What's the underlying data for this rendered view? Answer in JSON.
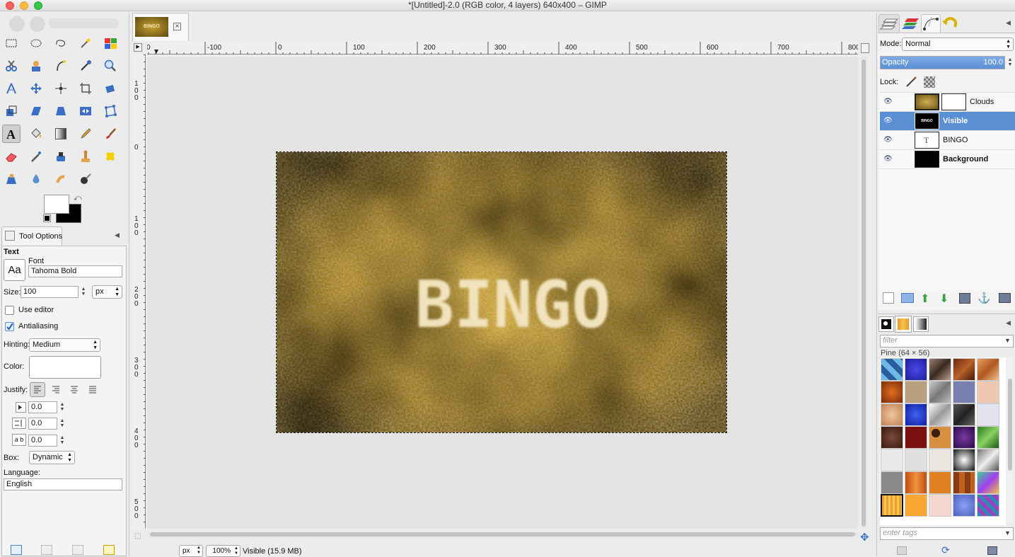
{
  "window": {
    "title": "*[Untitled]-2.0 (RGB color, 4 layers) 640x400 – GIMP"
  },
  "image_tab": {
    "thumb_label": "BINGO",
    "close_icon": "×"
  },
  "ruler": {
    "h_labels": [
      "0",
      "-100",
      "0",
      "100",
      "200",
      "300",
      "400",
      "500",
      "600",
      "700",
      "800"
    ],
    "v_labels": [
      [
        "1",
        "0",
        "0"
      ],
      [
        "0"
      ],
      [
        "1",
        "0",
        "0"
      ],
      [
        "2",
        "0",
        "0"
      ],
      [
        "3",
        "0",
        "0"
      ],
      [
        "4",
        "0",
        "0"
      ],
      [
        "5",
        "0",
        "0"
      ]
    ]
  },
  "canvas": {
    "text": "BINGO"
  },
  "statusbar": {
    "unit": "px",
    "zoom": "100%",
    "info": "Visible (15.9 MB)"
  },
  "tool_options": {
    "tab_label": "Tool Options",
    "section": "Text",
    "font_label": "Font",
    "font_icon": "Aa",
    "font_value": "Tahoma Bold",
    "size_label": "Size:",
    "size_value": "100",
    "size_unit": "px",
    "use_editor": "Use editor",
    "antialiasing": "Antialiasing",
    "hinting_label": "Hinting:",
    "hinting_value": "Medium",
    "color_label": "Color:",
    "justify_label": "Justify:",
    "indent_value": "0.0",
    "line_spacing_value": "0.0",
    "letter_spacing_value": "0.0",
    "letter_icon": "a b",
    "box_label": "Box:",
    "box_value": "Dynamic",
    "language_label": "Language:",
    "language_value": "English"
  },
  "layers": {
    "mode_label": "Mode:",
    "mode_value": "Normal",
    "opacity_label": "Opacity",
    "opacity_value": "100.0",
    "lock_label": "Lock:",
    "items": [
      {
        "name": "Clouds",
        "selected": false,
        "bold": false
      },
      {
        "name": "Visible",
        "selected": true,
        "bold": true
      },
      {
        "name": "BINGO",
        "selected": false,
        "bold": false
      },
      {
        "name": "Background",
        "selected": false,
        "bold": true
      }
    ]
  },
  "patterns": {
    "filter_placeholder": "filter",
    "current": "Pine (64 × 56)",
    "tags_placeholder": "enter tags"
  },
  "colors": {
    "accent": "#5b8fd4",
    "selected_row": "#5b8fd4"
  }
}
